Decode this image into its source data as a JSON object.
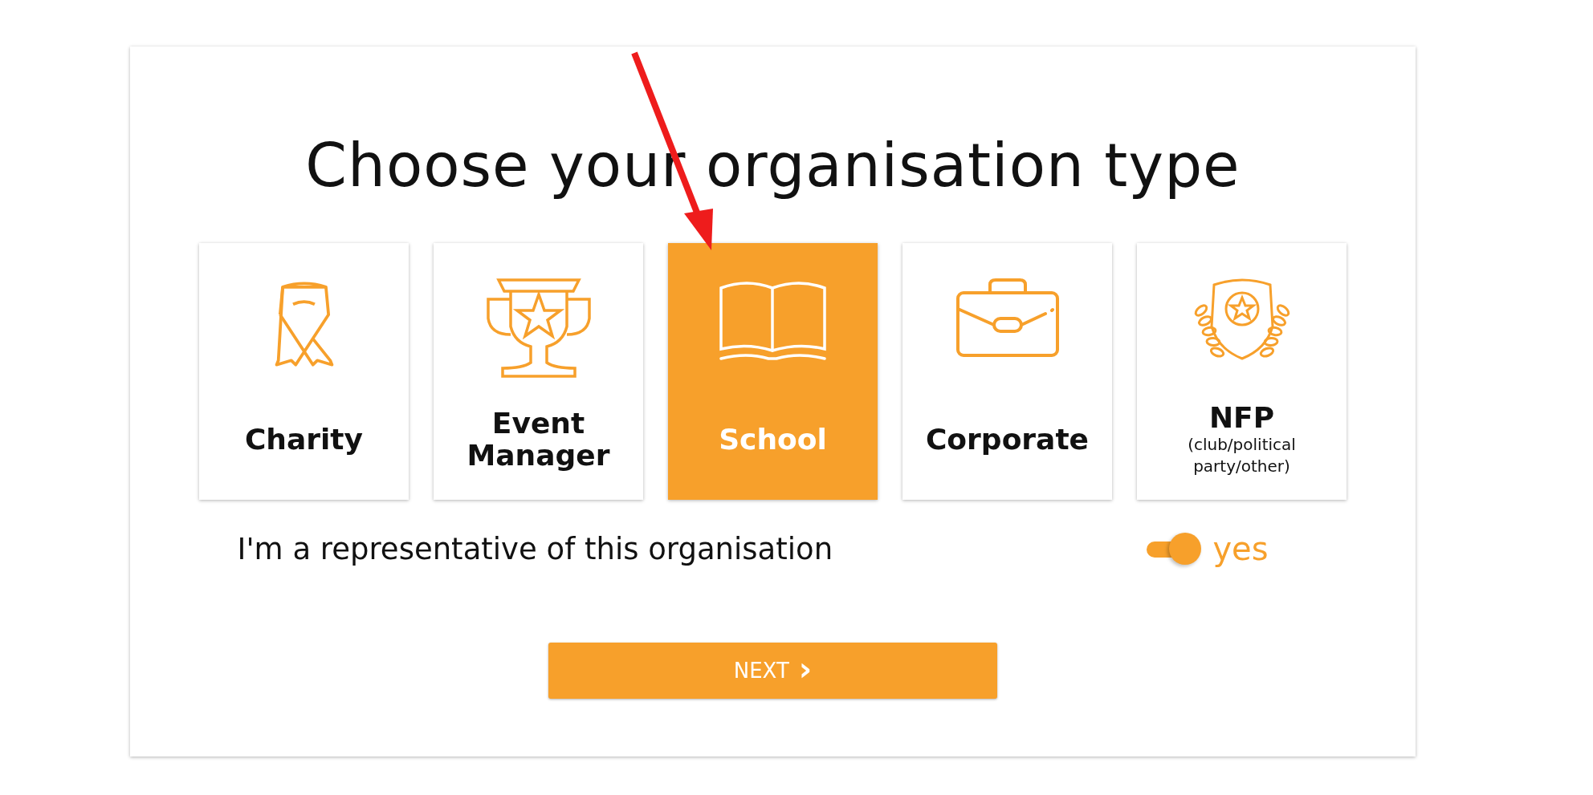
{
  "title": "Choose your organisation type",
  "options": [
    {
      "label": "Charity",
      "selected": false
    },
    {
      "label": "Event Manager",
      "selected": false
    },
    {
      "label": "School",
      "selected": true
    },
    {
      "label": "Corporate",
      "selected": false
    },
    {
      "label": "NFP",
      "note": "(club/political party/other)",
      "selected": false
    }
  ],
  "representative": {
    "label": "I'm a representative of this organisation",
    "on": true,
    "state_label": "yes"
  },
  "next_button": {
    "label": "NEXT",
    "icon": "›"
  }
}
